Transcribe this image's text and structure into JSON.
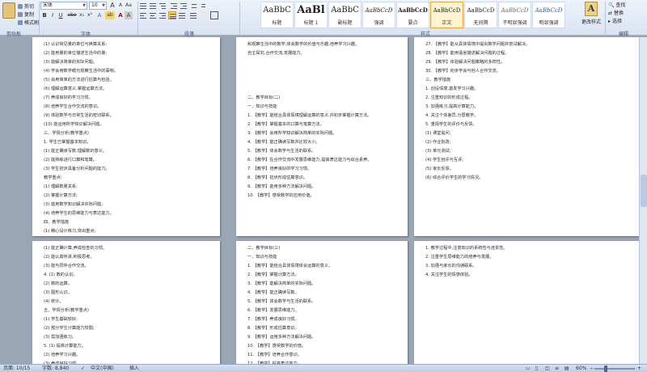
{
  "clipboard": {
    "paste_label": "",
    "cut_label": "剪切",
    "copy_label": "复制",
    "format_painter_label": "格式刷"
  },
  "font": {
    "name": "宋体",
    "size": "10",
    "grow_glyph": "A",
    "shrink_glyph": "A",
    "aa_glyph": "Aa",
    "clear_glyph": "A",
    "wen_glyph": "wén",
    "border_glyph": "A",
    "bold_glyph": "B",
    "italic_glyph": "I",
    "underline_glyph": "U",
    "strike_glyph": "abe",
    "sub_glyph": "x₂",
    "sup_glyph": "x²",
    "effect_glyph": "A",
    "highlight_glyph": "ab",
    "color_glyph": "A",
    "shade_glyph": "A",
    "circle_glyph": "A"
  },
  "styles": [
    {
      "sample": "AaBbC",
      "name": "标题"
    },
    {
      "sample": "AaBl",
      "name": "标题 1"
    },
    {
      "sample": "AaBbC",
      "name": "副标题"
    },
    {
      "sample": "AaBbCcD",
      "name": "强调"
    },
    {
      "sample": "AaBbCcD",
      "name": "要点"
    },
    {
      "sample": "AaBbCcD",
      "name": "正文"
    },
    {
      "sample": "AaBbCcD",
      "name": "无间隔"
    },
    {
      "sample": "AaBbCcD",
      "name": "不明显强调"
    },
    {
      "sample": "AaBbCcD",
      "name": "明显强调"
    },
    {
      "sample": "AaBbCcD",
      "name": "引用"
    },
    {
      "sample": "AaBbCcD",
      "name": "明显引用"
    }
  ],
  "change_styles_label": "更改样式",
  "editing": {
    "find_label": "查找",
    "replace_label": "替换",
    "select_label": "选择"
  },
  "group_labels": {
    "clipboard": "剪贴板",
    "font": "字体",
    "paragraph": "段落",
    "styles": "样式",
    "editing": "编辑"
  },
  "pages": [
    {
      "lines": [
        "(1) 认识常见量的单位与换算关系;",
        "(2) 能用量的单位描述生活中的量;",
        "(3) 能解决简单的实际问题。",
        "(4) 学会用数学眼光观察生活中的事物。",
        "(5) 会用简单的方法进行估算与检验。",
        "(6) 理解运算意义,掌握运算方法。",
        "(7) 养成良好的学习习惯。",
        "(8) 培养学生合作交流的意识。",
        "(9) 体验数学与日常生活的密切联系。",
        "(10) 能运用所学知识解决问题。",
        "三、学情分析(教学重点)",
        "1. 学生已掌握基本知识。",
        "(1) 能正确读写数,理解数的意义。",
        "(2) 能熟练进行口算和笔算。",
        "(3) 学生初步具备分析问题的能力。",
        "教学重点:",
        "(1) 理解数量关系;",
        "(2) 掌握计算方法;",
        "(3) 能用数学知识解决实际问题;",
        "(4) 培养学生的思维能力与表达能力。",
        "四、教学措施",
        "(1) 精心设计练习,突出重点;",
        "(2) 加强直观教学,帮助理解;",
        "(3) 注重学生自主探究与合作学习。",
        "(4) 关注学困生,因材施教。"
      ]
    },
    {
      "lines": [
        "和观察生活中的数学,体会数学的价值与乐趣,培养学习兴趣。",
        "自主探究,合作交流,发展能力。",
        "",
        "",
        "",
        "",
        "二、教学目标(二)",
        "一、知识与技能",
        "1. 【教学】能结合具体情境理解运算的意义,并初步掌握计算方法。",
        "2. 【教学】掌握基本的口算与笔算方法。",
        "3. 【教学】会用所学知识解决简单的实际问题。",
        "4. 【教学】能正确读写数并比较大小。",
        "5. 【教学】体会数学与生活的联系。",
        "6. 【教学】在合作交流中发展思维能力,提高表达能力与综合素养。",
        "7. 【教学】培养良好的学习习惯。",
        "8. 【教学】初步形成估算意识。",
        "9. 【教学】能用多种方法解决问题。",
        "10. 【教学】感受数学的应用价值。"
      ]
    },
    {
      "lines": [
        "27. 【教学】能从具体情境中提出数学问题并尝试解决。",
        "28. 【教学】能用语言描述解决问题的过程。",
        "29. 【教学】体验解决问题策略的多样性。",
        "30. 【教学】初步学会与他人合作交流。",
        "三、教学措施",
        "1. 创设情境,激发学习兴趣。",
        "2. 注重知识的形成过程。",
        "3. 加强练习,提高计算能力。",
        "4. 关注个体差异,分层教学。",
        "5. 重视学生的评价与反馈。",
        "(1) 课堂提问;",
        "(2) 作业批改;",
        "(3) 单元测试;",
        "(4) 学生自评与互评;",
        "(5) 家长反馈。",
        "(6) 综合评价学生的学习情况。"
      ]
    },
    {
      "lines": [
        "(1) 能正确计算,养成检查的习惯。",
        "(2) 能认真听讲,积极思考。",
        "(3) 能与同伴合作交流。",
        "4. (1) 数的认识。",
        "(2) 数的运算。",
        "(3) 图形认识。",
        "(4) 统计。",
        "五、学情分析(教学重点)",
        "(1) 学生基础较好;",
        "(2) 部分学生计算能力较弱;",
        "(3) 需加强练习。",
        "5. (1) 提高计算能力。",
        "(2) 培养学习兴趣。",
        "(3) 养成良好习惯。",
        "六、教学进度安排"
      ]
    },
    {
      "lines": [
        "二、教学目标(三)",
        "一、知识与技能",
        "1. 【教学】能结合具体情境体会运算的意义。",
        "2. 【教学】掌握计算方法。",
        "3. 【教学】能解决简单的实际问题。",
        "4. 【教学】能正确读写数。",
        "5. 【教学】体会数学与生活的联系。",
        "6. 【教学】发展思维能力。",
        "7. 【教学】养成良好习惯。",
        "8. 【教学】形成估算意识。",
        "9. 【教学】运用多种方法解决问题。",
        "10. 【教学】感受数学的价值。",
        "11. 【教学】培养合作意识。",
        "12. 【教学】提高表达能力。",
        "13. 【教学】增强学习信心。"
      ]
    },
    {
      "lines": [
        "1. 教学过程中,注意知识的系统性与连贯性。",
        "2. 注重学生思维能力的培养与发展。",
        "3. 加强与家长的沟通联系。",
        "4. 关注学生的情感体验。"
      ]
    }
  ],
  "status": {
    "page": "页面: 10/15",
    "words": "字数: 8,840",
    "language": "中文(中国)",
    "mode": "插入",
    "zoom": "60%",
    "zoom_level": 0.6
  }
}
